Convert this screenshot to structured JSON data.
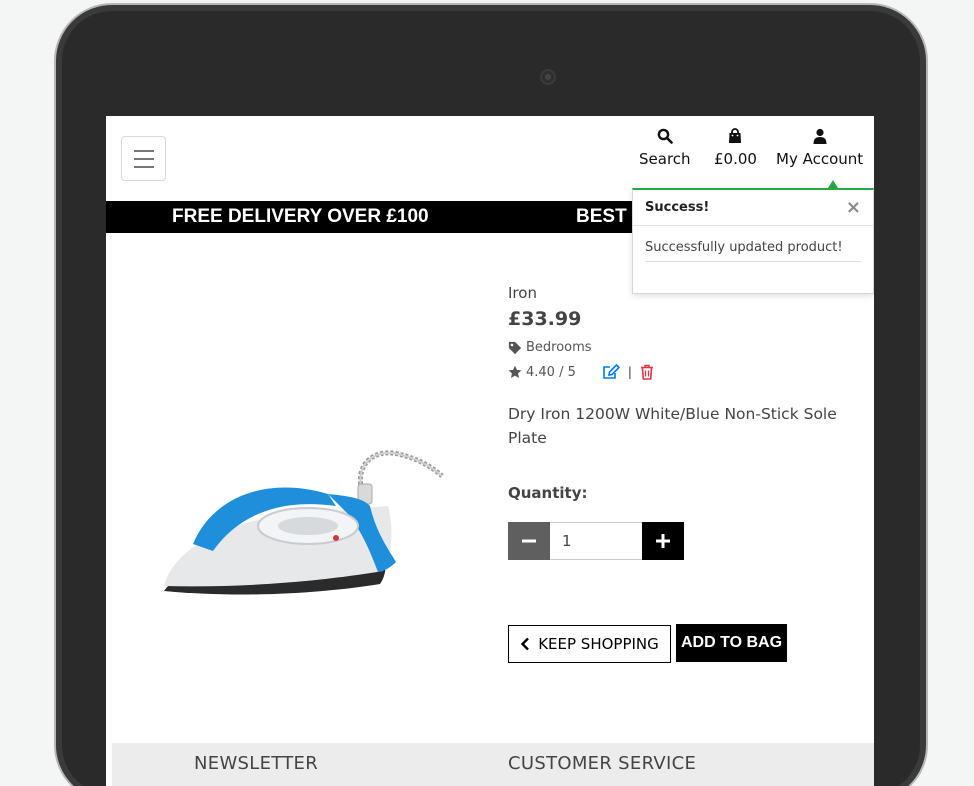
{
  "nav": {
    "search_label": "Search",
    "bag_total": "£0.00",
    "account_label": "My Account"
  },
  "banner": {
    "message_1": "FREE DELIVERY OVER £100",
    "message_2": "BEST P"
  },
  "toast": {
    "title": "Success!",
    "close": "×",
    "message": "Successfully updated product!",
    "accent_color": "#28a745"
  },
  "product": {
    "name": "Iron",
    "price": "£33.99",
    "category": "Bedrooms",
    "rating": "4.40 / 5",
    "rating_separator": "|",
    "description": "Dry Iron 1200W White/Blue Non-Stick Sole Plate",
    "quantity_label": "Quantity:",
    "quantity_value": "1",
    "edit_color": "#007bff",
    "delete_color": "#dc3545"
  },
  "actions": {
    "keep_shopping": "KEEP SHOPPING",
    "add_to_bag": "ADD TO BAG"
  },
  "footer": {
    "newsletter": "NEWSLETTER",
    "customer_service": "CUSTOMER SERVICE"
  }
}
